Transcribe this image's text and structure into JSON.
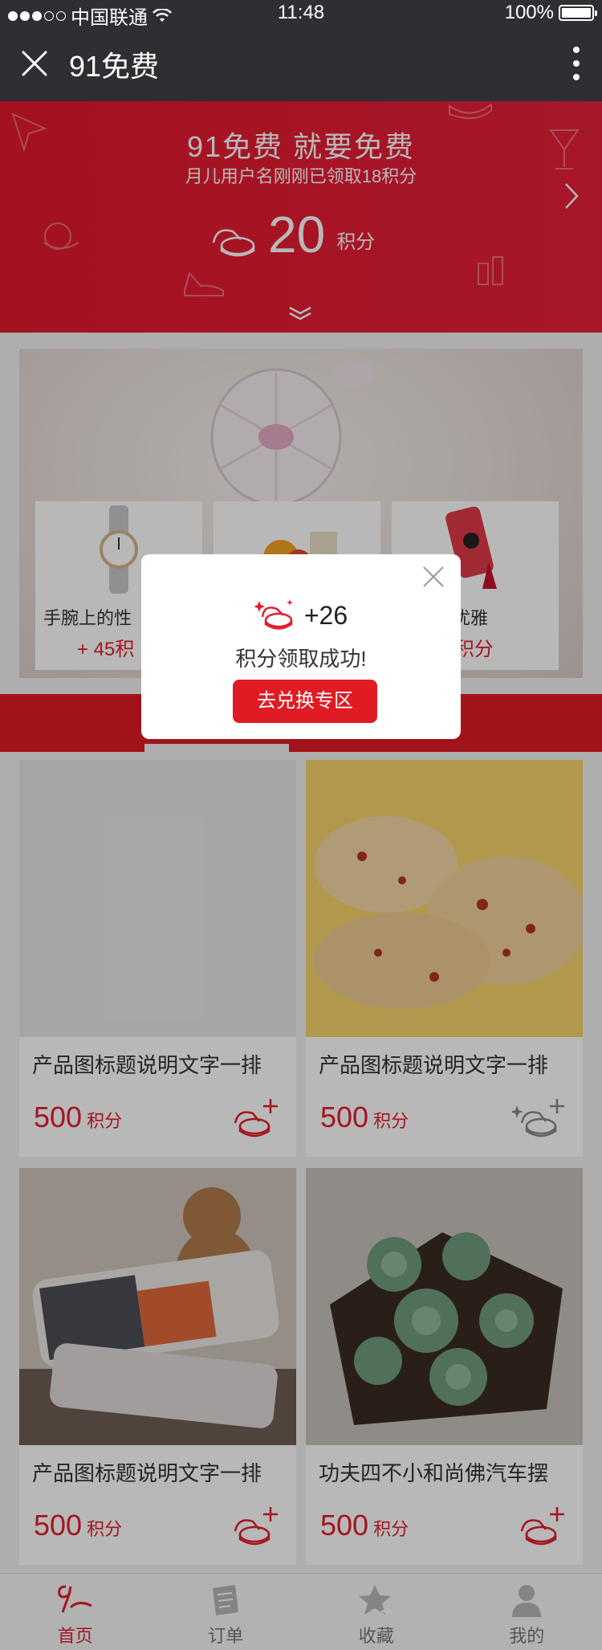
{
  "status_bar": {
    "carrier": "中国联通",
    "time": "11:48",
    "battery": "100%"
  },
  "navbar": {
    "title": "91免费"
  },
  "banner": {
    "headline": "91免费  就要免费",
    "subline": "月儿用户名刚刚已领取18积分",
    "points_value": "20",
    "points_unit": "积分"
  },
  "feature": {
    "cards": [
      {
        "name": "手腕上的性",
        "points": "+ 45积"
      },
      {
        "name": "",
        "points": ""
      },
      {
        "name": "的性感优雅",
        "points": "45积分"
      }
    ]
  },
  "products": [
    {
      "title": "产品图标题说明文字一排",
      "price": "500",
      "unit": "积分"
    },
    {
      "title": "产品图标题说明文字一排",
      "price": "500",
      "unit": "积分"
    },
    {
      "title": "产品图标题说明文字一排",
      "price": "500",
      "unit": "积分"
    },
    {
      "title": "功夫四不小和尚佛汽车摆",
      "price": "500",
      "unit": "积分"
    }
  ],
  "tabbar": {
    "items": [
      {
        "label": "首页",
        "icon": "home-logo-icon",
        "active": true
      },
      {
        "label": "订单",
        "icon": "order-icon",
        "active": false
      },
      {
        "label": "收藏",
        "icon": "favorite-star-icon",
        "active": false
      },
      {
        "label": "我的",
        "icon": "user-icon",
        "active": false
      }
    ]
  },
  "modal": {
    "reward": "+26",
    "message": "积分领取成功!",
    "button_label": "去兑换专区"
  },
  "colors": {
    "brand_red": "#e01b23",
    "navbar": "#2d2f33"
  }
}
